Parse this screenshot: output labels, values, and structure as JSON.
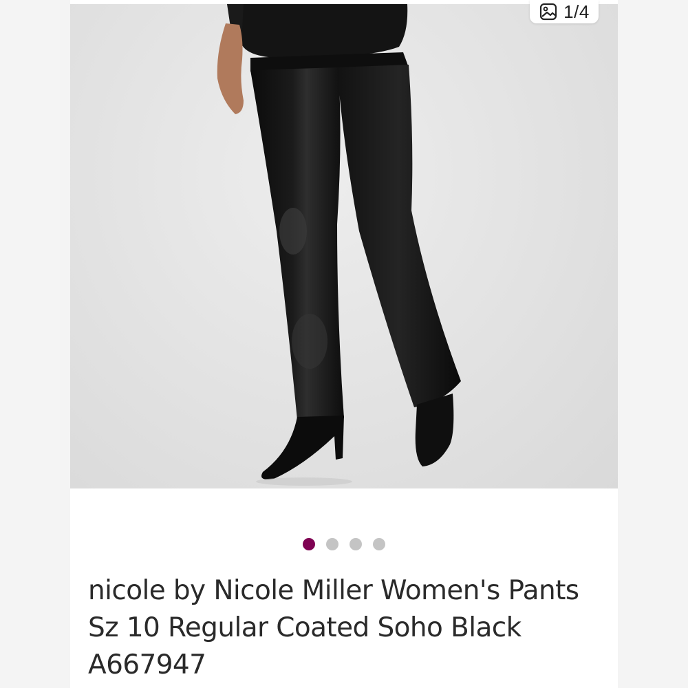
{
  "gallery": {
    "image_counter": "1/4",
    "counter_icon": "image-icon",
    "image_subject": "",
    "dots": [
      {
        "active": true
      },
      {
        "active": false
      },
      {
        "active": false
      },
      {
        "active": false
      }
    ],
    "active_color": "#7f0353",
    "inactive_color": "#c4c4c4"
  },
  "listing": {
    "title": "nicole by Nicole Miller Women's Pants Sz 10 Regular Coated Soho Black A667947"
  }
}
